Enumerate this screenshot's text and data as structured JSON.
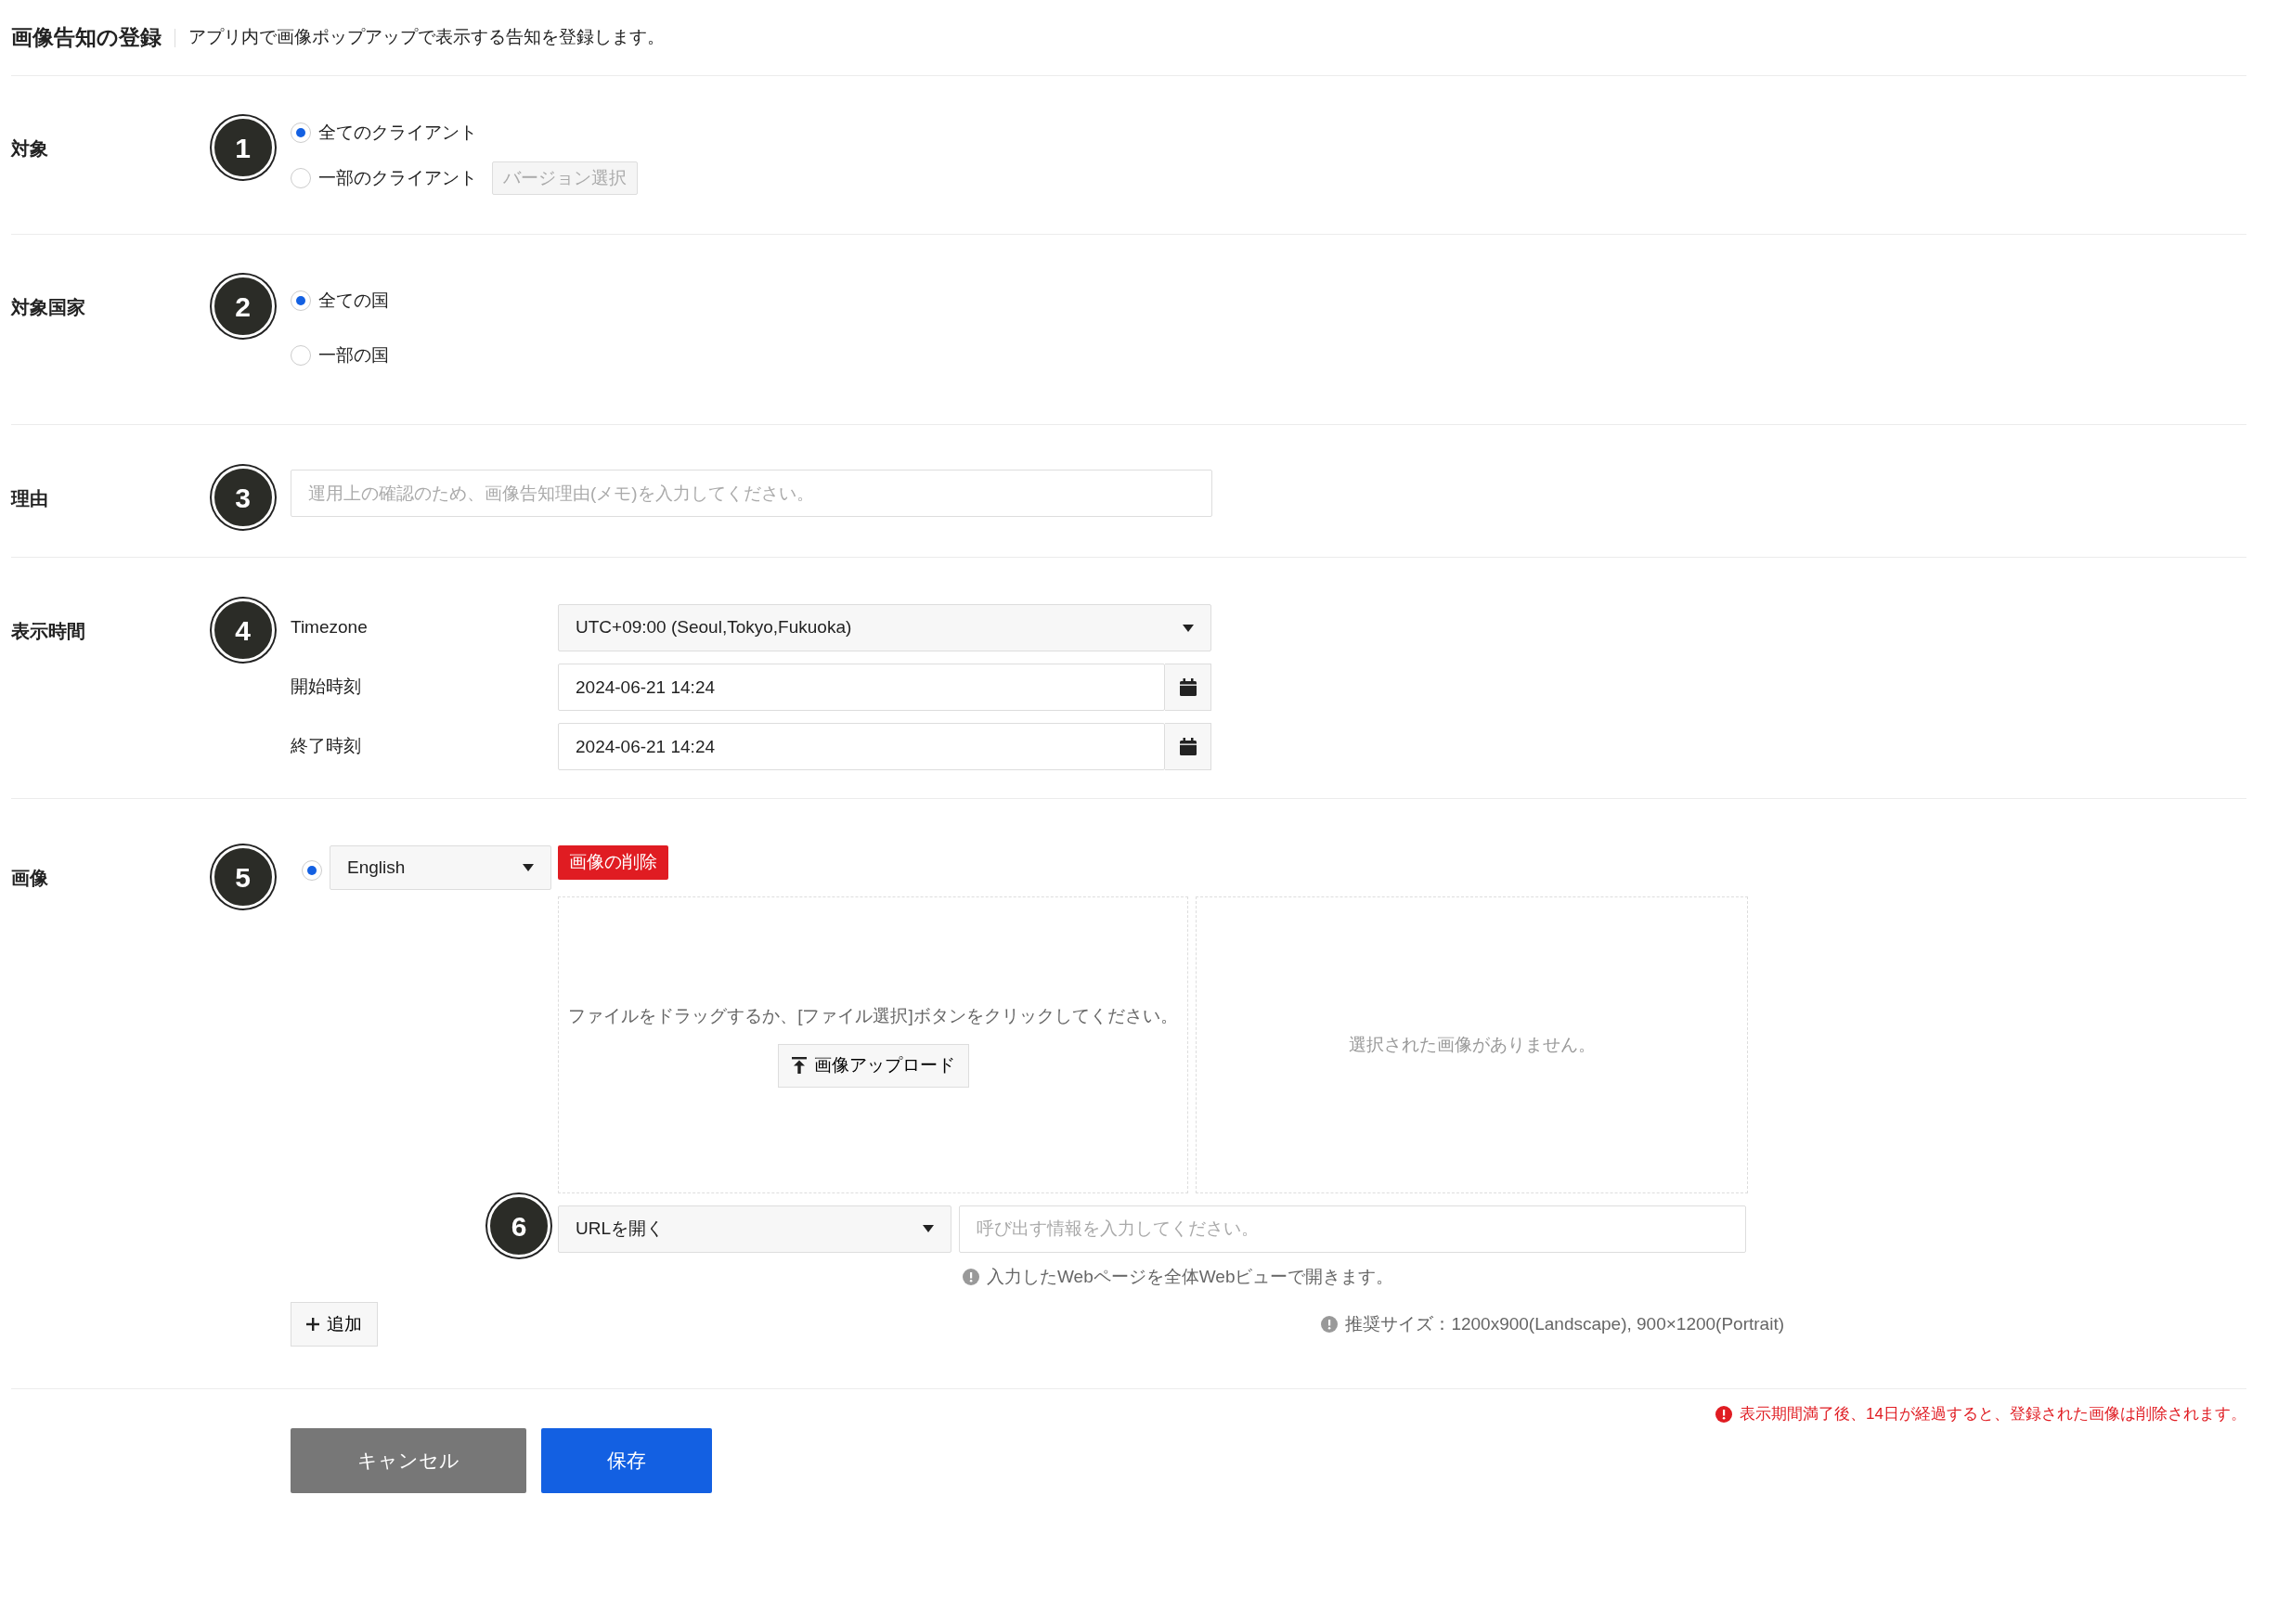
{
  "header": {
    "title": "画像告知の登録",
    "description": "アプリ内で画像ポップアップで表示する告知を登録します。"
  },
  "target": {
    "label": "対象",
    "step": "1",
    "options": [
      {
        "label": "全てのクライアント",
        "selected": true
      },
      {
        "label": "一部のクライアント",
        "selected": false,
        "button": {
          "label": "バージョン選択",
          "disabled": true
        }
      }
    ]
  },
  "country": {
    "label": "対象国家",
    "step": "2",
    "options": [
      {
        "label": "全ての国",
        "selected": true
      },
      {
        "label": "一部の国",
        "selected": false
      }
    ]
  },
  "reason": {
    "label": "理由",
    "step": "3",
    "placeholder": "運用上の確認のため、画像告知理由(メモ)を入力してください。"
  },
  "display_time": {
    "label": "表示時間",
    "step": "4",
    "fields": [
      {
        "kind": "select",
        "label": "Timezone",
        "value": "UTC+09:00 (Seoul,Tokyo,Fukuoka)"
      },
      {
        "kind": "date",
        "label": "開始時刻",
        "value": "2024-06-21 14:24"
      },
      {
        "kind": "date",
        "label": "終了時刻",
        "value": "2024-06-21 14:24"
      }
    ]
  },
  "image": {
    "label": "画像",
    "step": "5",
    "entries": [
      {
        "selected": true,
        "language": "English",
        "delete_button": "画像の削除",
        "drop_hint": "ファイルをドラッグするか、[ファイル選択]ボタンをクリックしてください。",
        "upload_button": "画像アップロード",
        "preview_empty": "選択された画像がありません。",
        "link_step": "6",
        "action": "URLを開く",
        "action_placeholder": "呼び出す情報を入力してください。",
        "action_note": "入力したWebページを全体Webビューで開きます。"
      }
    ],
    "add_button": "追加",
    "size_note": "推奨サイズ：1200x900(Landscape), 900×1200(Portrait)"
  },
  "footer": {
    "warning": "表示期間満了後、14日が経過すると、登録された画像は削除されます。",
    "cancel": "キャンセル",
    "save": "保存"
  }
}
